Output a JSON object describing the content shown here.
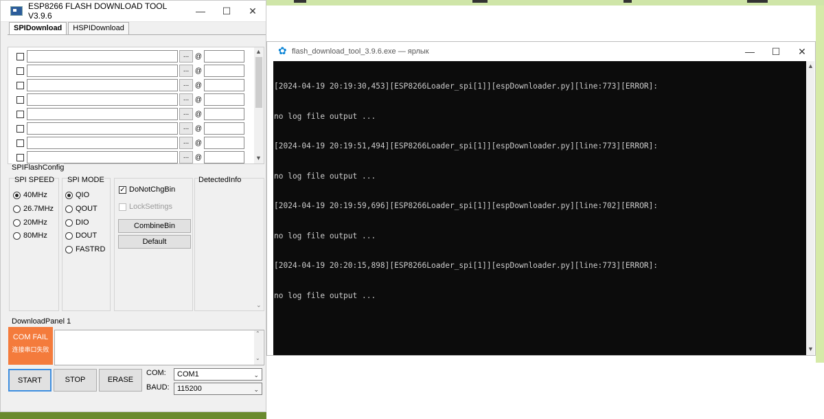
{
  "esp_window": {
    "title": "ESP8266 FLASH DOWNLOAD TOOL V3.9.6",
    "tabs": [
      "SPIDownload",
      "HSPIDownload"
    ],
    "file_rows": [
      {
        "checked": false,
        "path": "",
        "at": "@",
        "address": ""
      },
      {
        "checked": false,
        "path": "",
        "at": "@",
        "address": ""
      },
      {
        "checked": false,
        "path": "",
        "at": "@",
        "address": ""
      },
      {
        "checked": false,
        "path": "",
        "at": "@",
        "address": ""
      },
      {
        "checked": false,
        "path": "",
        "at": "@",
        "address": ""
      },
      {
        "checked": false,
        "path": "",
        "at": "@",
        "address": ""
      },
      {
        "checked": false,
        "path": "",
        "at": "@",
        "address": ""
      },
      {
        "checked": false,
        "path": "",
        "at": "@",
        "address": ""
      }
    ],
    "browse_label": "...",
    "spi_flash_config": {
      "label": "SPIFlashConfig",
      "spi_speed": {
        "label": "SPI SPEED",
        "options": [
          "40MHz",
          "26.7MHz",
          "20MHz",
          "80MHz"
        ],
        "selected": "40MHz"
      },
      "spi_mode": {
        "label": "SPI MODE",
        "options": [
          "QIO",
          "QOUT",
          "DIO",
          "DOUT",
          "FASTRD"
        ],
        "selected": "QIO"
      },
      "do_not_chg_bin": {
        "label": "DoNotChgBin",
        "checked": true
      },
      "lock_settings": {
        "label": "LockSettings",
        "checked": false
      },
      "combine_bin": "CombineBin",
      "default": "Default",
      "detected_info": "DetectedInfo"
    },
    "download_panel": {
      "label": "DownloadPanel 1",
      "status": "COM FAIL",
      "status_sub": "连接串口失败",
      "status_color": "#f47b3c",
      "start": "START",
      "stop": "STOP",
      "erase": "ERASE",
      "com_label": "COM:",
      "com_value": "COM1",
      "baud_label": "BAUD:",
      "baud_value": "115200"
    }
  },
  "console_window": {
    "title": "flash_download_tool_3.9.6.exe — ярлык",
    "lines": [
      "[2024-04-19 20:19:30,453][ESP8266Loader_spi[1]][espDownloader.py][line:773][ERROR]:",
      "no log file output ...",
      "[2024-04-19 20:19:51,494][ESP8266Loader_spi[1]][espDownloader.py][line:773][ERROR]:",
      "no log file output ...",
      "[2024-04-19 20:19:59,696][ESP8266Loader_spi[1]][espDownloader.py][line:702][ERROR]:",
      "no log file output ...",
      "[2024-04-19 20:20:15,898][ESP8266Loader_spi[1]][espDownloader.py][line:773][ERROR]:",
      "no log file output ..."
    ]
  },
  "window_controls": {
    "minimize": "—",
    "maximize": "☐",
    "close": "✕"
  }
}
